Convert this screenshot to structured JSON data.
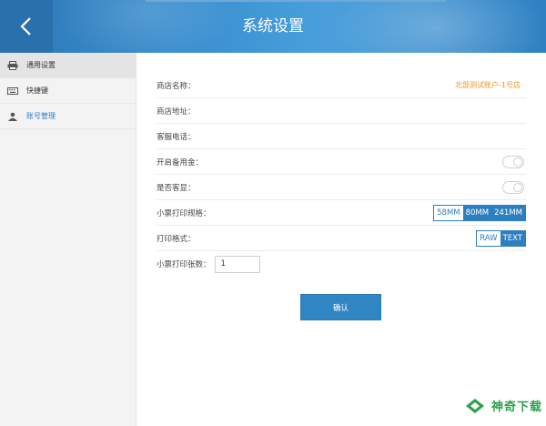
{
  "header": {
    "title": "系统设置",
    "back_icon": "chevron-left-icon"
  },
  "sidebar": {
    "items": [
      {
        "label": "通用设置",
        "icon": "printer-icon"
      },
      {
        "label": "快捷键",
        "icon": "keyboard-icon"
      },
      {
        "label": "账号管理",
        "icon": "user-icon"
      }
    ]
  },
  "settings": {
    "store_name_label": "商店名称：",
    "store_name_value": "北部测试账户-1号店",
    "store_address_label": "商店地址：",
    "service_phone_label": "客服电话：",
    "reserve_fund_label": "开启备用金：",
    "customer_display_label": "是否客显：",
    "receipt_size_label": "小票打印规格：",
    "receipt_size_options": [
      "58MM",
      "80MM",
      "241MM"
    ],
    "receipt_size_selected": "58MM",
    "print_format_label": "打印格式：",
    "print_format_options": [
      "RAW",
      "TEXT"
    ],
    "print_format_selected": "RAW",
    "print_count_label": "小票打印张数：",
    "print_count_value": "1"
  },
  "actions": {
    "confirm_label": "确认"
  },
  "watermark": {
    "text": "神奇下载"
  },
  "colors": {
    "accent": "#2d7fc0",
    "header": "#3a8fd0",
    "orange_value": "#f0921e",
    "watermark_green": "#2aa34a"
  }
}
